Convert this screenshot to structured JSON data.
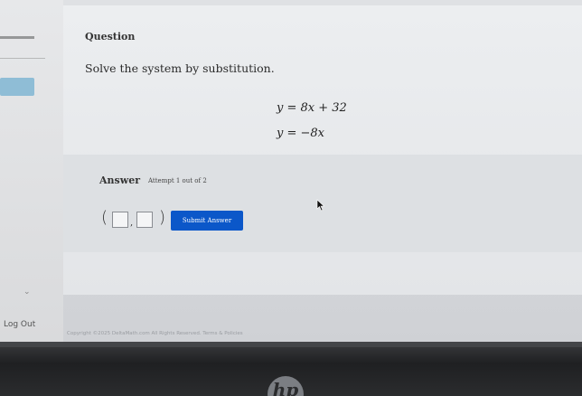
{
  "sidebar": {
    "logout_label": "Log Out"
  },
  "question": {
    "label": "Question",
    "prompt": "Solve the system by substitution.",
    "equations": [
      "y = 8x + 32",
      "y = −8x"
    ]
  },
  "answer": {
    "label": "Answer",
    "attempt_text": "Attempt 1 out of 2",
    "open_paren": "(",
    "comma": ",",
    "close_paren": ")",
    "submit_label": "Submit Answer"
  },
  "footer": {
    "copyright": "Copyright ©2025 DeltaMath.com All Rights Reserved. Terms & Policies"
  },
  "bezel": {
    "logo_text": "hp"
  },
  "colors": {
    "submit_bg": "#0b57c9",
    "active_sidebar": "#8fbdd6"
  }
}
